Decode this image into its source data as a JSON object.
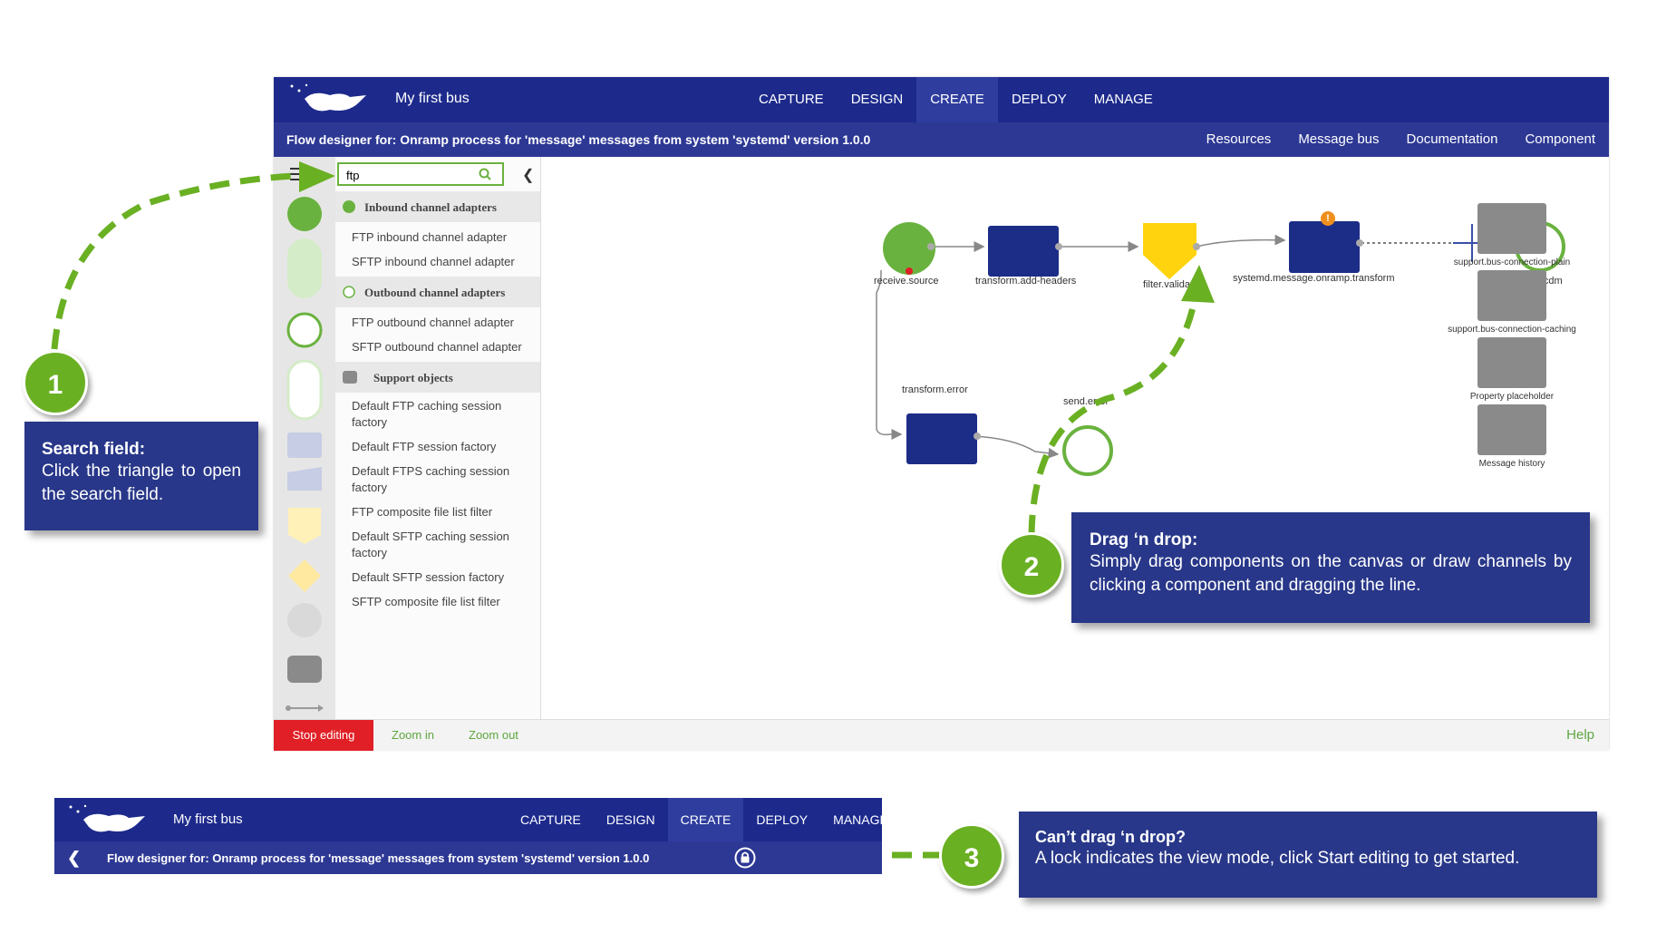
{
  "app": {
    "name": "My first bus",
    "nav": [
      "CAPTURE",
      "DESIGN",
      "CREATE",
      "DEPLOY",
      "MANAGE"
    ],
    "active_nav": "CREATE",
    "subtitle": "Flow designer for: Onramp process for 'message' messages from system 'systemd' version 1.0.0",
    "sublinks": [
      "Resources",
      "Message bus",
      "Documentation",
      "Component"
    ]
  },
  "sidebar": {
    "search_value": "ftp",
    "groups": [
      {
        "label": "Inbound channel adapters",
        "items": [
          "FTP inbound channel adapter",
          "SFTP inbound channel adapter"
        ]
      },
      {
        "label": "Outbound channel adapters",
        "items": [
          "FTP outbound channel adapter",
          "SFTP outbound channel adapter"
        ]
      },
      {
        "label": "Support objects",
        "items": [
          "Default FTP caching session factory",
          "Default FTP session factory",
          "Default FTPS caching session factory",
          "FTP composite file list filter",
          "Default SFTP caching session factory",
          "Default SFTP session factory",
          "SFTP composite file list filter"
        ]
      }
    ]
  },
  "canvas": {
    "nodes": {
      "receive_source": "receive.source",
      "transform_add_headers": "transform.add-headers",
      "filter_validate": "filter.validate",
      "systemd_transform": "systemd.message.onramp.transform",
      "send_cdm": "send.cdm",
      "transform_error": "transform.error",
      "send_error": "send.error"
    },
    "support": [
      "support.bus-connection-plain",
      "support.bus-connection-caching",
      "Property placeholder",
      "Message history"
    ]
  },
  "footer": {
    "stop": "Stop editing",
    "zoom_in": "Zoom in",
    "zoom_out": "Zoom out",
    "help": "Help"
  },
  "callouts": {
    "c1": {
      "num": "1",
      "title": "Search field:",
      "body": "Click the triangle to open the search field."
    },
    "c2": {
      "num": "2",
      "title": "Drag ‘n drop:",
      "body": "Simply drag components on the canvas or draw channels by clicking a component and dragging the line."
    },
    "c3": {
      "num": "3",
      "title": "Can’t drag ‘n drop?",
      "body": "A lock indicates the view mode, click Start editing to get started."
    }
  },
  "colors": {
    "navy": "#1d2a8c",
    "green": "#6ab023",
    "node_blue": "#1c2d87",
    "yellow": "#ffd40f",
    "red": "#e01f26"
  }
}
